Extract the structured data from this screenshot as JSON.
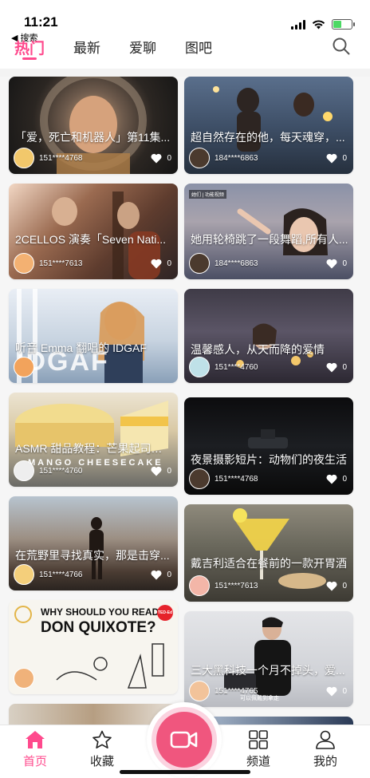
{
  "status_bar": {
    "time": "11:21",
    "back_label": "◀ 搜索",
    "battery_level": 0.45,
    "battery_color": "#4cd964"
  },
  "tabs": [
    {
      "label": "热门",
      "active": true
    },
    {
      "label": "最新",
      "active": false
    },
    {
      "label": "爱聊",
      "active": false
    },
    {
      "label": "图吧",
      "active": false
    }
  ],
  "accent_color": "#ff4a8d",
  "cards": [
    {
      "title": "「爱，死亡和机器人」第11集...",
      "user": "151****4768",
      "likes": "0"
    },
    {
      "title": "超自然存在的他，每天魂穿，...",
      "user": "184****6863",
      "likes": "0"
    },
    {
      "title": "2CELLOS 演奏「Seven Nati...",
      "user": "151****7613",
      "likes": "0"
    },
    {
      "title": "她用轮椅跳了一段舞蹈,所有人...",
      "user": "184****6863",
      "likes": "0",
      "badge": "她们 | 功能视频"
    },
    {
      "title": "听音 Emma 翻唱的 IDGAF",
      "user": "",
      "likes": "",
      "overlay": "IDGAF"
    },
    {
      "title": "温馨感人，从天而降的爱情",
      "user": "151****4760",
      "likes": "0"
    },
    {
      "title": "ASMR 甜品教程：芒果起司蛋糕",
      "user": "151****4760",
      "likes": "0",
      "overlay": "MANGO CHEESECAKE"
    },
    {
      "title": "夜景摄影短片：动物们的夜生活",
      "user": "151****4768",
      "likes": "0"
    },
    {
      "title": "在荒野里寻找真实，那是击穿...",
      "user": "151****4766",
      "likes": "0"
    },
    {
      "title": "戴吉利适合在餐前的一款开胃酒",
      "user": "151****7613",
      "likes": "0"
    },
    {
      "title": "",
      "user": "",
      "likes": "",
      "overlay_lines": [
        "WHY SHOULD YOU READ",
        "DON QUIXOTE?"
      ],
      "badge": "TED-Ed"
    },
    {
      "title": "三大黑科技一个月不掉头，爱...",
      "user": "151****4765",
      "likes": "0",
      "caption": "可以佩戴到拿走"
    }
  ],
  "bottom_nav": [
    {
      "label": "首页",
      "icon": "home-icon",
      "active": true
    },
    {
      "label": "收藏",
      "icon": "star-icon",
      "active": false
    },
    {
      "label": "频道",
      "icon": "grid-icon",
      "active": false
    },
    {
      "label": "我的",
      "icon": "user-icon",
      "active": false
    }
  ],
  "record_button": {
    "icon": "video-camera-icon"
  }
}
